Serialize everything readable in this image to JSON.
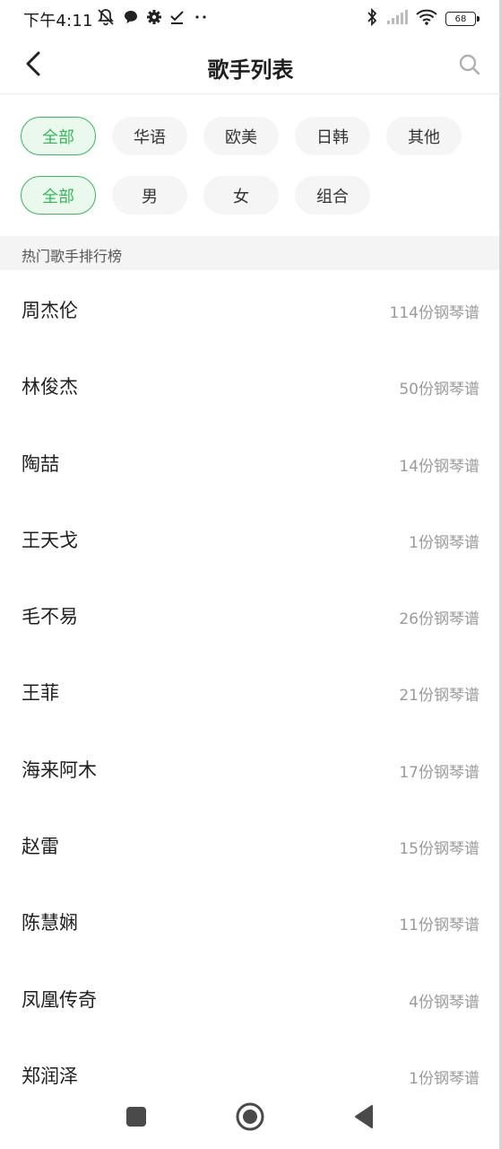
{
  "status_bar": {
    "time": "下午4:11",
    "left_icons": [
      "bell-off-icon",
      "chat-bubble-icon",
      "gear-icon",
      "check-icon",
      "dots-icon"
    ],
    "right_icons": [
      "bluetooth-icon",
      "signal-icon",
      "wifi-icon",
      "battery-icon"
    ],
    "battery_level": "68"
  },
  "header": {
    "title": "歌手列表",
    "back_icon": "chevron-left-icon",
    "search_icon": "search-icon"
  },
  "filters": {
    "region": [
      {
        "label": "全部",
        "active": true
      },
      {
        "label": "华语",
        "active": false
      },
      {
        "label": "欧美",
        "active": false
      },
      {
        "label": "日韩",
        "active": false
      },
      {
        "label": "其他",
        "active": false
      }
    ],
    "gender": [
      {
        "label": "全部",
        "active": true
      },
      {
        "label": "男",
        "active": false
      },
      {
        "label": "女",
        "active": false
      },
      {
        "label": "组合",
        "active": false
      }
    ],
    "active_color": "#38b85a"
  },
  "section": {
    "title": "热门歌手排行榜"
  },
  "artists": [
    {
      "name": "周杰伦",
      "count": "114份钢琴谱"
    },
    {
      "name": "林俊杰",
      "count": "50份钢琴谱"
    },
    {
      "name": "陶喆",
      "count": "14份钢琴谱"
    },
    {
      "name": "王天戈",
      "count": "1份钢琴谱"
    },
    {
      "name": "毛不易",
      "count": "26份钢琴谱"
    },
    {
      "name": "王菲",
      "count": "21份钢琴谱"
    },
    {
      "name": "海来阿木",
      "count": "17份钢琴谱"
    },
    {
      "name": "赵雷",
      "count": "15份钢琴谱"
    },
    {
      "name": "陈慧娴",
      "count": "11份钢琴谱"
    },
    {
      "name": "凤凰传奇",
      "count": "4份钢琴谱"
    },
    {
      "name": "郑润泽",
      "count": "1份钢琴谱"
    }
  ],
  "nav_bar": {
    "buttons": [
      "recents-square-icon",
      "home-circle-icon",
      "back-triangle-icon"
    ]
  }
}
